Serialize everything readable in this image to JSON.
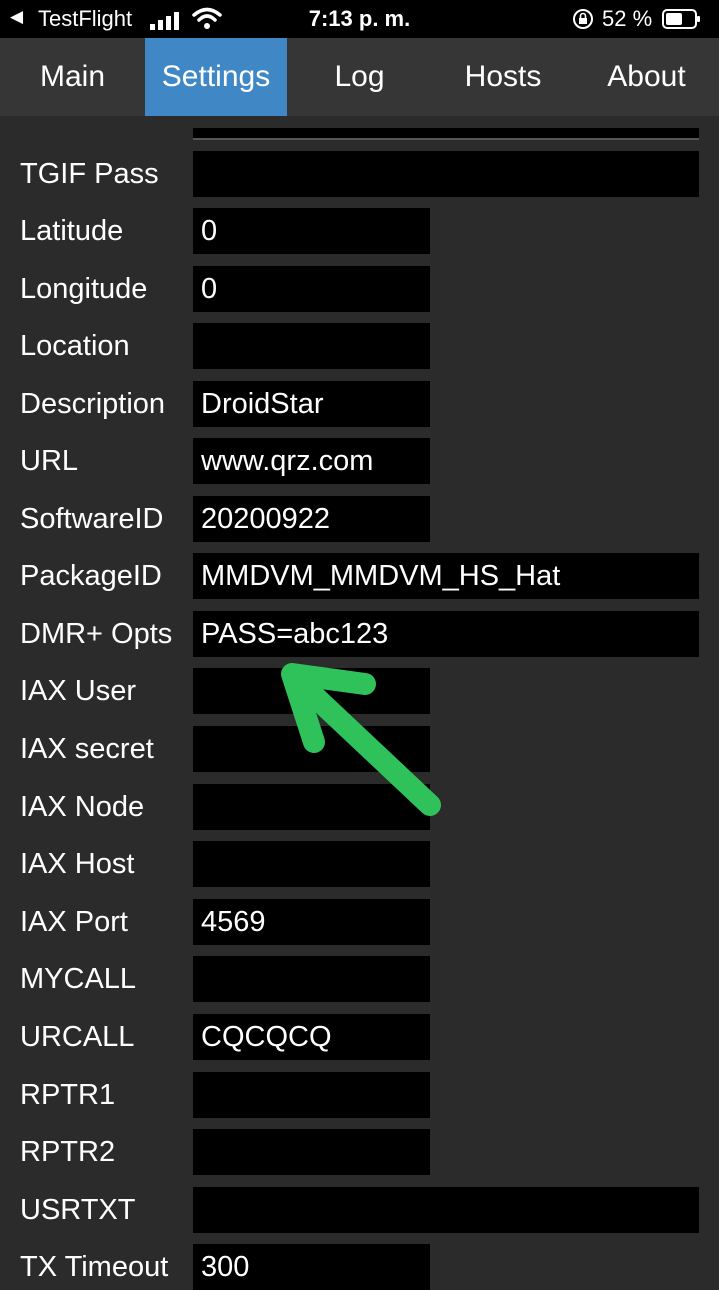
{
  "status_bar": {
    "back_icon": "back-arrow-icon",
    "app": "TestFlight",
    "time": "7:13 p. m.",
    "battery_pct": "52 %",
    "icons": [
      "signal-icon",
      "wifi-icon",
      "orientation-lock-icon",
      "battery-icon"
    ]
  },
  "tabs": [
    {
      "label": "Main",
      "active": false
    },
    {
      "label": "Settings",
      "active": true
    },
    {
      "label": "Log",
      "active": false
    },
    {
      "label": "Hosts",
      "active": false
    },
    {
      "label": "About",
      "active": false
    }
  ],
  "fields": [
    {
      "label": "TGIF Pass",
      "value": ""
    },
    {
      "label": "Latitude",
      "value": "0"
    },
    {
      "label": "Longitude",
      "value": "0"
    },
    {
      "label": "Location",
      "value": ""
    },
    {
      "label": "Description",
      "value": "DroidStar"
    },
    {
      "label": "URL",
      "value": "www.qrz.com"
    },
    {
      "label": "SoftwareID",
      "value": "20200922"
    },
    {
      "label": "PackageID",
      "value": "MMDVM_MMDVM_HS_Hat"
    },
    {
      "label": "DMR+ Opts",
      "value": "PASS=abc123"
    },
    {
      "label": "IAX User",
      "value": ""
    },
    {
      "label": "IAX secret",
      "value": ""
    },
    {
      "label": "IAX Node",
      "value": ""
    },
    {
      "label": "IAX Host",
      "value": ""
    },
    {
      "label": "IAX Port",
      "value": "4569"
    },
    {
      "label": "MYCALL",
      "value": ""
    },
    {
      "label": "URCALL",
      "value": "CQCQCQ"
    },
    {
      "label": "RPTR1",
      "value": ""
    },
    {
      "label": "RPTR2",
      "value": ""
    },
    {
      "label": "USRTXT",
      "value": ""
    },
    {
      "label": "TX Timeout",
      "value": "300"
    }
  ],
  "annotation": {
    "icon": "green-arrow-icon",
    "color": "#2fc25b"
  }
}
